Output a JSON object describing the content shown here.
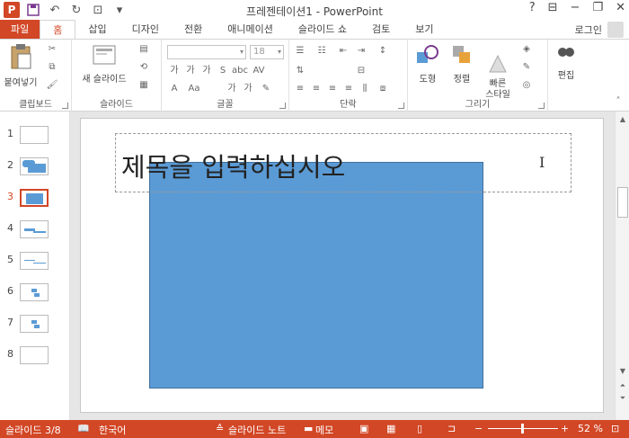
{
  "window": {
    "title": "프레젠테이션1 - PowerPoint"
  },
  "tabs": [
    {
      "label": "파일"
    },
    {
      "label": "홈"
    },
    {
      "label": "삽입"
    },
    {
      "label": "디자인"
    },
    {
      "label": "전환"
    },
    {
      "label": "애니메이션"
    },
    {
      "label": "슬라이드 쇼"
    },
    {
      "label": "검토"
    },
    {
      "label": "보기"
    }
  ],
  "account": {
    "login_label": "로그인"
  },
  "ribbon": {
    "clipboard": {
      "paste_label": "붙여넣기",
      "group_label": "클립보드"
    },
    "slides": {
      "new_slide_label": "새 슬라이드",
      "group_label": "슬라이드"
    },
    "font": {
      "font_size": "18",
      "group_label": "글꼴"
    },
    "paragraph": {
      "group_label": "단락"
    },
    "drawing": {
      "shapes_label": "도형",
      "arrange_label": "정렬",
      "quick_styles_label": "빠른\n스타일",
      "group_label": "그리기"
    },
    "editing": {
      "edit_label": "편집"
    }
  },
  "thumbnails": [
    "1",
    "2",
    "3",
    "4",
    "5",
    "6",
    "7",
    "8"
  ],
  "slide": {
    "title_placeholder": "제목을 입력하십시오",
    "shape_color": "#5b9bd5"
  },
  "statusbar": {
    "slide_info": "슬라이드 3/8",
    "language": "한국어",
    "notes_label": "슬라이드 노트",
    "comments_label": "메모",
    "zoom": "52 %"
  },
  "colors": {
    "accent": "#d24726"
  }
}
